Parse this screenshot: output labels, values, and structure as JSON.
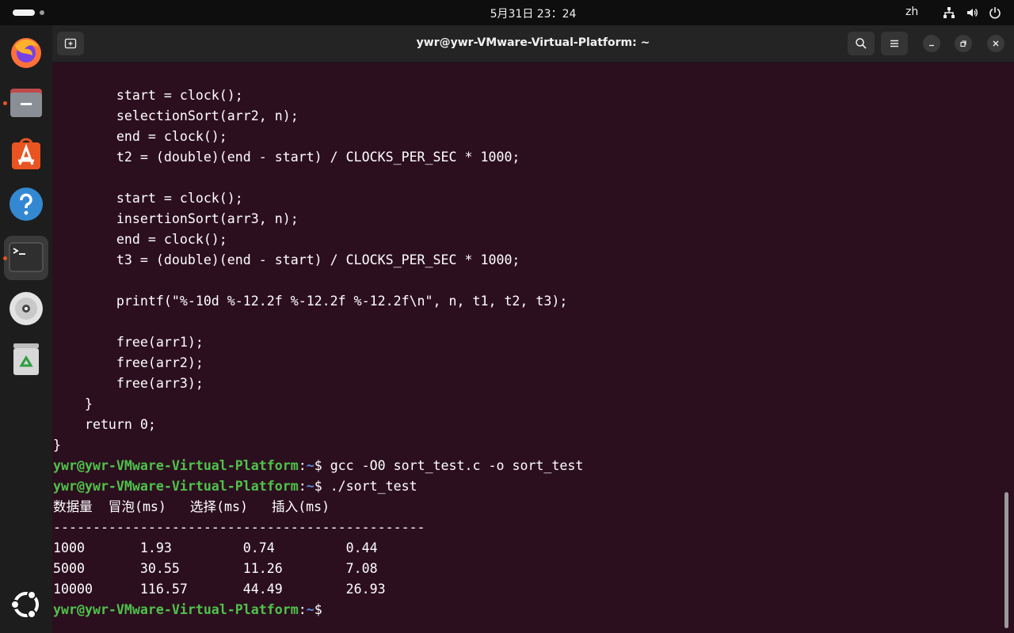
{
  "topbar": {
    "clock": "5月31日  23：24",
    "lang": "zh",
    "icons": [
      "network-icon",
      "volume-icon",
      "power-icon"
    ]
  },
  "dock": {
    "apps": [
      {
        "name": "firefox-icon",
        "running": false
      },
      {
        "name": "files-icon",
        "running": true
      },
      {
        "name": "app-center-icon",
        "running": false
      },
      {
        "name": "help-icon",
        "running": false
      },
      {
        "name": "terminal-icon",
        "running": true,
        "active": true
      },
      {
        "name": "disc-icon",
        "running": false
      },
      {
        "name": "trash-icon",
        "running": false
      },
      {
        "name": "show-apps-icon",
        "running": false
      }
    ]
  },
  "window": {
    "title": "ywr@ywr-VMware-Virtual-Platform: ~",
    "colors": {
      "background": "#2c0f1f",
      "prompt_user": "#4ec34a",
      "prompt_path": "#5a8fd6",
      "accent": "#e95420"
    }
  },
  "terminal": {
    "code_lines": [
      "        start = clock();",
      "        selectionSort(arr2, n);",
      "        end = clock();",
      "        t2 = (double)(end - start) / CLOCKS_PER_SEC * 1000;",
      "",
      "        start = clock();",
      "        insertionSort(arr3, n);",
      "        end = clock();",
      "        t3 = (double)(end - start) / CLOCKS_PER_SEC * 1000;",
      "",
      "        printf(\"%-10d %-12.2f %-12.2f %-12.2f\\n\", n, t1, t2, t3);",
      "",
      "        free(arr1);",
      "        free(arr2);",
      "        free(arr3);",
      "    }",
      "    return 0;",
      "}"
    ],
    "prompt_user": "ywr@ywr-VMware-Virtual-Platform",
    "prompt_sep": ":",
    "prompt_path": "~",
    "prompt_end": "$ ",
    "commands": [
      "gcc -O0 sort_test.c -o sort_test",
      "./sort_test"
    ],
    "output": {
      "header": "数据量  冒泡(ms)   选择(ms)   插入(ms)",
      "divider": "-----------------------------------------------",
      "rows": [
        "1000       1.93         0.74         0.44",
        "5000       30.55        11.26        7.08",
        "10000      116.57       44.49        26.93"
      ]
    }
  }
}
